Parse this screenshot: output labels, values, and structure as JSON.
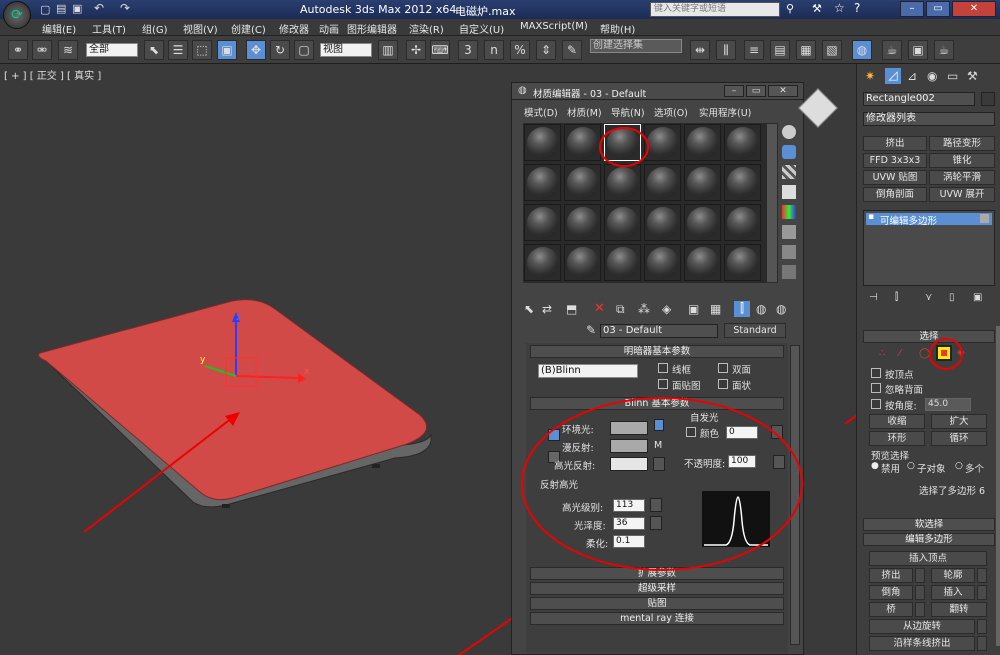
{
  "app": {
    "title": "Autodesk 3ds Max  2012 x64",
    "file": "电磁炉.max",
    "search_placeholder": "键入关键字或短语"
  },
  "menu": [
    "编辑(E)",
    "工具(T)",
    "组(G)",
    "视图(V)",
    "创建(C)",
    "修改器",
    "动画",
    "图形编辑器",
    "渲染(R)",
    "自定义(U)",
    "MAXScript(M)",
    "帮助(H)"
  ],
  "toolbar": {
    "filter_value": "全部",
    "refcoord_value": "视图",
    "selection_set_placeholder": "创建选择集",
    "snap_label": "3",
    "percent_snap_label": "%",
    "angle_snap_label": "n"
  },
  "viewport": {
    "label": "[ + ] [ 正交 ] [ 真实 ]",
    "gizmo_x": "x",
    "gizmo_y": "y",
    "gizmo_z": "z",
    "object_color": "#d24a48"
  },
  "material_editor": {
    "title": "材质编辑器 - 03 - Default",
    "menu": [
      "模式(D)",
      "材质(M)",
      "导航(N)",
      "选项(O)",
      "实用程序(U)"
    ],
    "material_name": "03 - Default",
    "material_type": "Standard",
    "shader_rollout": "明暗器基本参数",
    "shader_type": "(B)Blinn",
    "wire": "线框",
    "two_sided": "双面",
    "face_map": "面贴图",
    "faceted": "面状",
    "blinn_rollout": "Blinn 基本参数",
    "self_illum": "自发光",
    "color": "颜色",
    "color_value": "0",
    "ambient": "环境光:",
    "diffuse": "漫反射:",
    "specular": "高光反射:",
    "opacity": "不透明度:",
    "opacity_value": "100",
    "diffuse_map_btn": "M",
    "ambient_color": "#a9a9a9",
    "diffuse_color": "#a9a9a9",
    "specular_color": "#e6e6e6",
    "spec_highlights": "反射高光",
    "spec_level": "高光级别:",
    "spec_level_value": "113",
    "glossiness": "光泽度:",
    "glossiness_value": "36",
    "soften": "柔化:",
    "soften_value": "0.1",
    "rollouts": [
      "扩展参数",
      "超级采样",
      "贴图",
      "mental ray 连接"
    ]
  },
  "command_panel": {
    "object_name": "Rectangle002",
    "modifier_list": "修改器列表",
    "modifier_buttons": [
      "挤出",
      "路径变形",
      "FFD 3x3x3",
      "锥化",
      "UVW 贴图",
      "涡轮平滑",
      "倒角剖面",
      "UVW 展开"
    ],
    "stack_item": "可编辑多边形",
    "selection_rollout": "选择",
    "by_vertex": "按顶点",
    "ignore_backfacing": "忽略背面",
    "by_angle": "按角度:",
    "angle_value": "45.0",
    "shrink": "收缩",
    "grow": "扩大",
    "ring": "环形",
    "loop": "循环",
    "preview_selection": "预览选择",
    "preview_options": [
      "禁用",
      "子对象",
      "多个"
    ],
    "selection_status": "选择了多边形 6",
    "soft_selection": "软选择",
    "edit_polygons": "编辑多边形",
    "insert_vertex": "插入顶点",
    "edit_buttons": [
      "挤出",
      "轮廓",
      "倒角",
      "插入",
      "桥",
      "翻转"
    ],
    "hinge_from_edge": "从边旋转",
    "extrude_along_spline": "沿样条线挤出",
    "polygon_icon_color": "#ffea00"
  }
}
